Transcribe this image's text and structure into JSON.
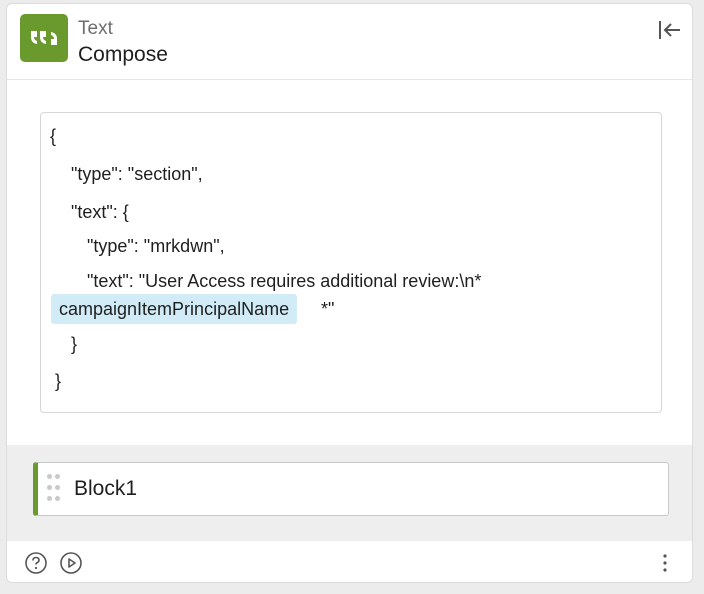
{
  "header": {
    "category": "Text",
    "title": "Compose",
    "app_icon": "quote-icon",
    "collapse_icon": "collapse-left-icon"
  },
  "editor": {
    "lines": [
      "{",
      "\"type\": \"section\",",
      "\"text\": {",
      "\"type\": \"mrkdwn\",",
      "\"text\": \"User Access requires additional review:\\n*",
      "}",
      "}"
    ],
    "token": "campaignItemPrincipalName",
    "token_tail": "*\""
  },
  "block": {
    "label": "Block1"
  },
  "footer": {
    "help_icon": "help-icon",
    "play_icon": "play-icon",
    "more_icon": "more-vertical-icon"
  },
  "colors": {
    "accent": "#6a9a2e",
    "token_bg": "#d1ebf7",
    "block_area_bg": "#eeeeee"
  }
}
